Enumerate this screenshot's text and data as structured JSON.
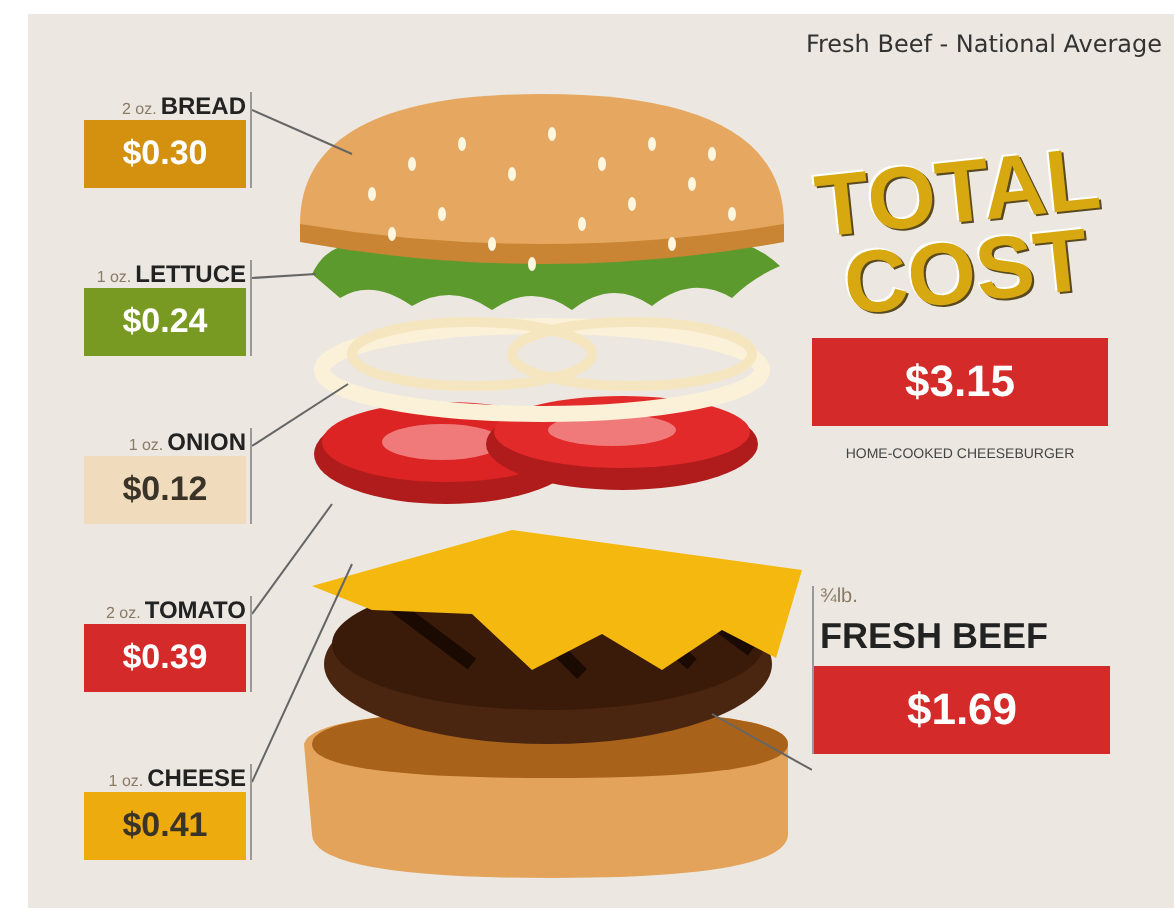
{
  "title": "Fresh Beef - National Average",
  "ingredients": [
    {
      "amount": "2 oz.",
      "name": "BREAD",
      "price": "$0.30",
      "color": "#d4900f"
    },
    {
      "amount": "1 oz.",
      "name": "LETTUCE",
      "price": "$0.24",
      "color": "#789a22"
    },
    {
      "amount": "1 oz.",
      "name": "ONION",
      "price": "$0.12",
      "color": "#f0dcbc"
    },
    {
      "amount": "2 oz.",
      "name": "TOMATO",
      "price": "$0.39",
      "color": "#d42a2a"
    },
    {
      "amount": "1 oz.",
      "name": "CHEESE",
      "price": "$0.41",
      "color": "#eeab0e"
    }
  ],
  "total": {
    "heading": "TOTAL COST",
    "price": "$3.15",
    "caption": "HOME-COOKED CHEESEBURGER"
  },
  "beef": {
    "amount": "¾lb.",
    "name": "FRESH BEEF",
    "price": "$1.69"
  }
}
